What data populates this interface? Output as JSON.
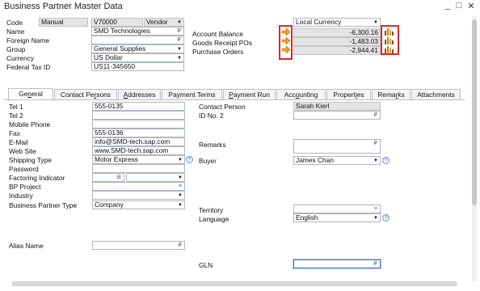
{
  "window": {
    "title": "Business Partner Master Data",
    "minimize": "_",
    "restore": "□",
    "close": "✕"
  },
  "header": {
    "code_label": "Code",
    "code_type": "Manual",
    "code_value": "V70000",
    "bp_type": "Vendor",
    "name_label": "Name",
    "name_value": "SMD Technologies",
    "foreign_name_label": "Foreign Name",
    "foreign_name_value": "",
    "group_label": "Group",
    "group_value": "General Supplies",
    "currency_label": "Currency",
    "currency_value": "US Dollar",
    "tax_label": "Federal Tax ID",
    "tax_value": "US11-345650",
    "currency_mode": "Local Currency",
    "balance_label": "Account Balance",
    "balance_value": "-6,300.16",
    "grpo_label": "Goods Receipt POs",
    "grpo_value": "-1,483.03",
    "po_label": "Purchase Orders",
    "po_value": "-2,944.41"
  },
  "tabs": {
    "general_pre": "Ge",
    "general_u": "n",
    "general_post": "eral",
    "contacts_pre": "Contact Pe",
    "contacts_u": "r",
    "contacts_post": "sons",
    "addresses_pre": "",
    "addresses_u": "A",
    "addresses_post": "ddresses",
    "payterms": "Payment Terms",
    "payrun_pre": "",
    "payrun_u": "P",
    "payrun_post": "ayment Run",
    "accounting_pre": "Acc",
    "accounting_u": "o",
    "accounting_post": "unting",
    "properties_pre": "Propert",
    "properties_u": "i",
    "properties_post": "es",
    "remarks_pre": "Rema",
    "remarks_u": "r",
    "remarks_post": "ks",
    "attachments": "Attachments"
  },
  "general": {
    "tel1_label": "Tel 1",
    "tel1_value": "555-0135",
    "tel2_label": "Tel 2",
    "tel2_value": "",
    "mobile_label": "Mobile Phone",
    "mobile_value": "",
    "fax_label": "Fax",
    "fax_value": "555-0136",
    "email_label": "E-Mail",
    "email_value": "info@SMD-tech.sap.com",
    "web_label": "Web Site",
    "web_value": "www.SMD-tech.sap.com",
    "shipping_label": "Shipping Type",
    "shipping_value": "Motor Express",
    "password_label": "Password",
    "password_value": "",
    "factoring_label": "Factoring Indicator",
    "bpproject_label": "BP Project",
    "industry_label": "Industry",
    "industry_value": "",
    "bptype_label": "Business Partner Type",
    "bptype_value": "Company",
    "alias_label": "Alias Name",
    "alias_value": "",
    "contact_label": "Contact Person",
    "contact_value": "Sarah Kierl",
    "id2_label": "ID No. 2",
    "id2_value": "",
    "remarks_label": "Remarks",
    "remarks_value": "",
    "buyer_label": "Buyer",
    "buyer_value": "James Chan",
    "territory_label": "Territory",
    "territory_value": "",
    "language_label": "Language",
    "language_value": "English",
    "gln_label": "GLN",
    "gln_value": ""
  },
  "icons": {
    "arrow": "→",
    "chart": "▮",
    "dropdown": "▼",
    "help": "?",
    "pick": "⊞",
    "link": "≡"
  },
  "colors": {
    "highlight_box": "#e2262b",
    "arrow_fill": "#f0a020",
    "chart_fill": "#c07a1a"
  }
}
